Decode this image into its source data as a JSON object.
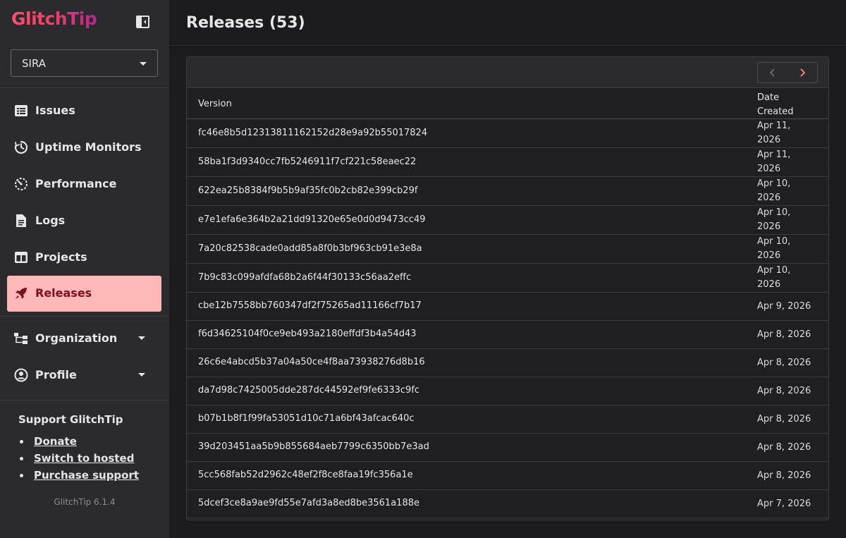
{
  "app": {
    "logo": "GlitchTip",
    "version": "GlitchTip 6.1.4"
  },
  "org_select": {
    "value": "SIRA"
  },
  "nav": [
    {
      "id": "issues",
      "label": "Issues",
      "icon": "list-icon"
    },
    {
      "id": "uptime",
      "label": "Uptime Monitors",
      "icon": "uptime-icon"
    },
    {
      "id": "performance",
      "label": "Performance",
      "icon": "performance-icon"
    },
    {
      "id": "logs",
      "label": "Logs",
      "icon": "document-icon"
    },
    {
      "id": "projects",
      "label": "Projects",
      "icon": "projects-icon"
    },
    {
      "id": "releases",
      "label": "Releases",
      "icon": "rocket-icon",
      "active": true
    }
  ],
  "nav_expand": [
    {
      "id": "organization",
      "label": "Organization",
      "icon": "org-tree-icon"
    },
    {
      "id": "profile",
      "label": "Profile",
      "icon": "user-circle-icon"
    }
  ],
  "support": {
    "heading": "Support GlitchTip",
    "links": [
      "Donate",
      "Switch to hosted",
      "Purchase support"
    ]
  },
  "page": {
    "title": "Releases (53)"
  },
  "table": {
    "columns": {
      "version": "Version",
      "date": "Date Created"
    },
    "rows": [
      {
        "version": "fc46e8b5d12313811162152d28e9a92b55017824",
        "date": "Apr 11,\n2026",
        "wrap": true
      },
      {
        "version": "58ba1f3d9340cc7fb5246911f7cf221c58eaec22",
        "date": "Apr 11,\n2026",
        "wrap": true
      },
      {
        "version": "622ea25b8384f9b5b9af35fc0b2cb82e399cb29f",
        "date": "Apr 10,\n2026",
        "wrap": true
      },
      {
        "version": "e7e1efa6e364b2a21dd91320e65e0d0d9473cc49",
        "date": "Apr 10,\n2026",
        "wrap": true
      },
      {
        "version": "7a20c82538cade0add85a8f0b3bf963cb91e3e8a",
        "date": "Apr 10,\n2026",
        "wrap": true
      },
      {
        "version": "7b9c83c099afdfa68b2a6f44f30133c56aa2effc",
        "date": "Apr 10,\n2026",
        "wrap": true
      },
      {
        "version": "cbe12b7558bb760347df2f75265ad11166cf7b17",
        "date": "Apr 9, 2026",
        "wrap": false
      },
      {
        "version": "f6d34625104f0ce9eb493a2180effdf3b4a54d43",
        "date": "Apr 8, 2026",
        "wrap": false
      },
      {
        "version": "26c6e4abcd5b37a04a50ce4f8aa73938276d8b16",
        "date": "Apr 8, 2026",
        "wrap": false
      },
      {
        "version": "da7d98c7425005dde287dc44592ef9fe6333c9fc",
        "date": "Apr 8, 2026",
        "wrap": false
      },
      {
        "version": "b07b1b8f1f99fa53051d10c71a6bf43afcac640c",
        "date": "Apr 8, 2026",
        "wrap": false
      },
      {
        "version": "39d203451aa5b9b855684aeb7799c6350bb7e3ad",
        "date": "Apr 8, 2026",
        "wrap": false
      },
      {
        "version": "5cc568fab52d2962c48ef2f8ce8faa19fc356a1e",
        "date": "Apr 8, 2026",
        "wrap": false
      },
      {
        "version": "5dcef3ce8a9ae9fd55e7afd3a8ed8be3561a188e",
        "date": "Apr 7, 2026",
        "wrap": false
      }
    ]
  },
  "colors": {
    "accent": "#ffb8b8",
    "active_text": "#7a1020",
    "sidebar_bg": "#2b2b2e",
    "page_bg": "#1b1b1d"
  }
}
